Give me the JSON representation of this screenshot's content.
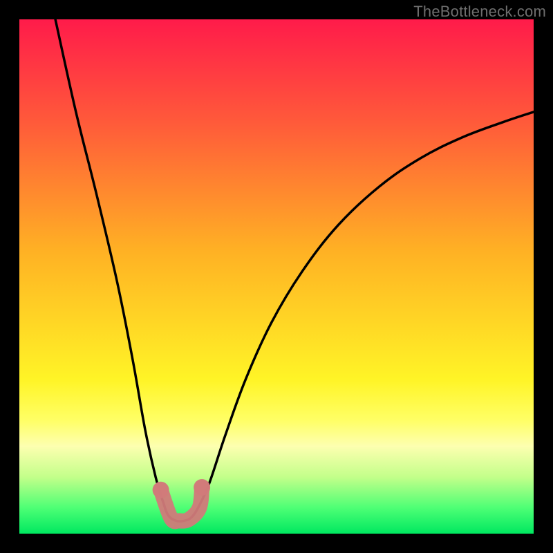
{
  "watermark": "TheBottleneck.com",
  "chart_data": {
    "type": "line",
    "title": "",
    "xlabel": "",
    "ylabel": "",
    "xlim": [
      0,
      100
    ],
    "ylim": [
      0,
      100
    ],
    "grid": false,
    "legend": false,
    "gradient_stops": [
      {
        "offset": 0,
        "color": "#ff1b4a"
      },
      {
        "offset": 0.2,
        "color": "#ff5a3a"
      },
      {
        "offset": 0.45,
        "color": "#ffb124"
      },
      {
        "offset": 0.7,
        "color": "#fff426"
      },
      {
        "offset": 0.78,
        "color": "#ffff66"
      },
      {
        "offset": 0.83,
        "color": "#fdffb0"
      },
      {
        "offset": 0.89,
        "color": "#c3ff8a"
      },
      {
        "offset": 0.95,
        "color": "#4dff75"
      },
      {
        "offset": 1.0,
        "color": "#00e860"
      }
    ],
    "series": [
      {
        "name": "curve",
        "stroke": "#000000",
        "points": [
          {
            "x": 7.0,
            "y": 100.0
          },
          {
            "x": 11.0,
            "y": 82.0
          },
          {
            "x": 15.0,
            "y": 66.0
          },
          {
            "x": 19.0,
            "y": 49.0
          },
          {
            "x": 22.0,
            "y": 34.0
          },
          {
            "x": 24.5,
            "y": 20.0
          },
          {
            "x": 26.5,
            "y": 11.0
          },
          {
            "x": 28.0,
            "y": 6.0
          },
          {
            "x": 29.0,
            "y": 3.5
          },
          {
            "x": 30.5,
            "y": 2.5
          },
          {
            "x": 32.0,
            "y": 2.5
          },
          {
            "x": 33.5,
            "y": 3.2
          },
          {
            "x": 35.0,
            "y": 5.5
          },
          {
            "x": 37.0,
            "y": 10.0
          },
          {
            "x": 40.0,
            "y": 19.0
          },
          {
            "x": 44.0,
            "y": 30.0
          },
          {
            "x": 49.0,
            "y": 41.0
          },
          {
            "x": 55.0,
            "y": 51.0
          },
          {
            "x": 62.0,
            "y": 60.0
          },
          {
            "x": 70.0,
            "y": 67.5
          },
          {
            "x": 78.0,
            "y": 73.0
          },
          {
            "x": 86.0,
            "y": 77.0
          },
          {
            "x": 94.0,
            "y": 80.0
          },
          {
            "x": 100.0,
            "y": 82.0
          }
        ]
      },
      {
        "name": "highlight-marker",
        "stroke": "#d17a7a",
        "points": [
          {
            "x": 27.5,
            "y": 8.5
          },
          {
            "x": 29.5,
            "y": 3.0
          },
          {
            "x": 31.0,
            "y": 2.5
          },
          {
            "x": 33.0,
            "y": 2.8
          },
          {
            "x": 35.0,
            "y": 5.0
          },
          {
            "x": 35.5,
            "y": 9.0
          }
        ]
      }
    ]
  }
}
